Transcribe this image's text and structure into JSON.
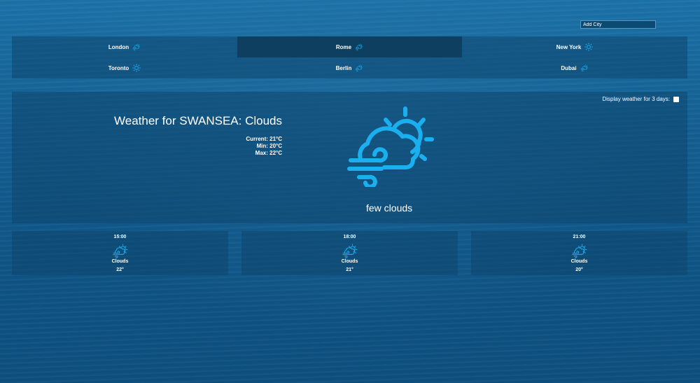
{
  "header": {
    "add_city_placeholder": "Add City"
  },
  "cities": [
    {
      "name": "London",
      "icon": "cloud-wind-sun-icon",
      "active": false
    },
    {
      "name": "Rome",
      "icon": "cloud-wind-sun-icon",
      "active": true
    },
    {
      "name": "New York",
      "icon": "sun-icon",
      "active": false
    },
    {
      "name": "Toronto",
      "icon": "sun-icon",
      "active": false
    },
    {
      "name": "Berlin",
      "icon": "cloud-wind-sun-icon",
      "active": false
    },
    {
      "name": "Dubai",
      "icon": "cloud-wind-sun-icon",
      "active": false
    }
  ],
  "main": {
    "toggle_label": "Display weather for 3 days:",
    "title": "Weather for SWANSEA: Clouds",
    "current": "Current: 21°C",
    "min": "Min: 20°C",
    "max": "Max: 22°C",
    "icon": "cloud-wind-sun-icon",
    "description": "few clouds"
  },
  "forecast": [
    {
      "time": "15:00",
      "condition": "Clouds",
      "temp": "22°",
      "icon": "cloud-wind-sun-icon"
    },
    {
      "time": "18:00",
      "condition": "Clouds",
      "temp": "21°",
      "icon": "cloud-wind-sun-icon"
    },
    {
      "time": "21:00",
      "condition": "Clouds",
      "temp": "20°",
      "icon": "cloud-wind-sun-icon"
    }
  ],
  "colors": {
    "accent": "#1ab0f0",
    "active_tab": "#0e3f60",
    "panel": "#0f466e"
  }
}
